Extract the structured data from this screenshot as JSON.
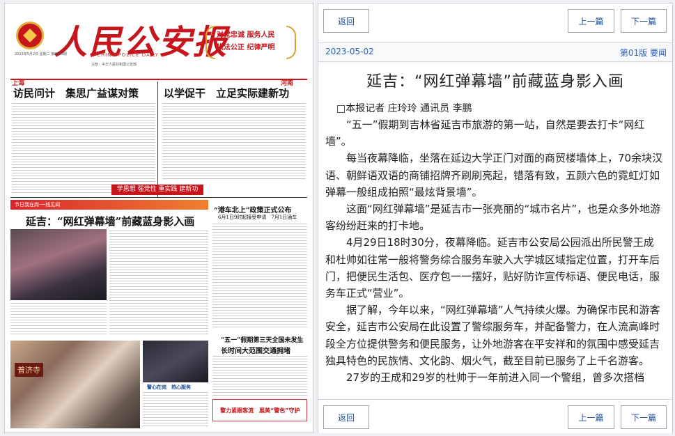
{
  "newspaper": {
    "masthead_title": "人民公安报",
    "masthead_english": "CHINA POLICE DAILY",
    "masthead_info": "2023年5月2日 星期二 第8989期",
    "masthead_info2": "主管：中华人民共和国公安部",
    "slogan_line1": "对党忠诚 服务人民",
    "slogan_line2": "执法公正 纪律严明",
    "section_left": "上海",
    "section_right": "河南",
    "headline_left": "访民问计　集思广益谋对策",
    "headline_right": "以学促干　立足实际建新功",
    "red_banner": "学思想 强党性 重实践 建新功",
    "holiday_strip": "节日我在岗·一线见闻",
    "main_headline": "延吉：“网红弹幕墙”前藏蓝身影入画",
    "hk_headline": "“港车北上”政策正式公布",
    "hk_subhead": "6月1日9时起接受申请　7月1日通车",
    "may1_headline": "“五一”假期第三天全国未发生",
    "may1_headline2": "长时间大范围交通拥堵",
    "photo_caption": "警心在岗　热心服务",
    "bottom_box": "警力紧跟客流　展美“警色”守护",
    "sign_text": "普济寺"
  },
  "toolbar_top": {
    "back": "返回",
    "prev": "上一篇",
    "next": "下一篇"
  },
  "meta": {
    "date": "2023-05-02",
    "page": "第01版 要闻"
  },
  "article": {
    "title": "延吉：“网红弹幕墙”前藏蓝身影入画",
    "author": "□本报记者 庄玲玲 通讯员 李鹏",
    "paragraphs": [
      "“五一”假期到吉林省延吉市旅游的第一站，自然是要去打卡“网红墙”。",
      "每当夜幕降临，坐落在延边大学正门对面的商贸楼墙体上，70余块汉语、朝鲜语双语的商铺招牌齐刷刷亮起，错落有致，五颜六色的霓虹灯如弹幕一般组成拍照“最炫背景墙”。",
      "这面“网红弹幕墙”是延吉市一张亮丽的“城市名片”，也是众多外地游客纷纷赶来的打卡地。",
      "4月29日18时30分，夜幕降临。延吉市公安局公园派出所民警王成和杜帅如往常一般将警务综合服务车驶入大学城区域指定位置，打开车后门，把便民生活包、医疗包一一摆好，贴好防诈宣传标语、便民电话，服务车正式“营业”。",
      "据了解，今年以来，“网红弹幕墙”人气持续火爆。为确保市民和游客安全，延吉市公安局在此设置了警综服务车，并配备警力，在人流高峰时段全方位提供警务和便民服务，让外地游客在平安祥和的氛围中感受延吉独具特色的民族情、文化韵、烟火气，截至目前已服务了上千名游客。",
      "27岁的王成和29岁的杜帅于一年前进入同一个警组，曾多次搭档"
    ]
  },
  "toolbar_bottom": {
    "back": "返回",
    "prev": "上一篇",
    "next": "下一篇"
  },
  "colors": {
    "accent_red": "#c6151b",
    "link_blue": "#2a63b8"
  }
}
